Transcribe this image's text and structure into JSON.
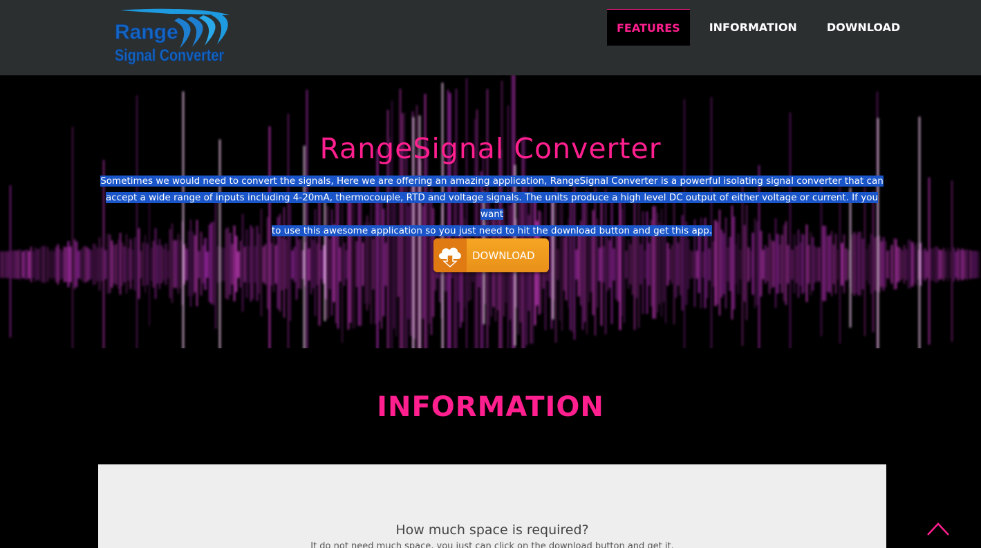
{
  "header": {
    "logo": {
      "line1": "Range",
      "line2": "Signal Converter"
    },
    "nav": [
      {
        "label": "FEATURES",
        "active": true
      },
      {
        "label": "INFORMATION",
        "active": false
      },
      {
        "label": "DOWNLOAD",
        "active": false
      }
    ]
  },
  "hero": {
    "title": "RangeSignal Converter",
    "description_lines": [
      "Sometimes we would need to convert the signals, Here we are offering an amazing application, RangeSignal Converter is a powerful isolating signal converter that can",
      "accept a wide range of inputs including 4-20mA, thermocouple, RTD and voltage signals. The units produce a high level DC output of either voltage or current. If you want",
      "to use this awesome application so you just need to hit the download button and get this app."
    ],
    "download_button": "DOWNLOAD"
  },
  "info": {
    "title": "INFORMATION",
    "faq": [
      {
        "question": "How much space is required?",
        "answer": "It do not need much space, you just can click on the download button and get it."
      }
    ]
  },
  "colors": {
    "accent": "#ff1f8e",
    "navbar": "#2b2f30",
    "button": "#f39c1f",
    "selection": "#1a56c9",
    "panel": "#eeeeee"
  },
  "icons": {
    "download": "cloud-download-icon",
    "scroll_top": "chevron-up-icon"
  }
}
